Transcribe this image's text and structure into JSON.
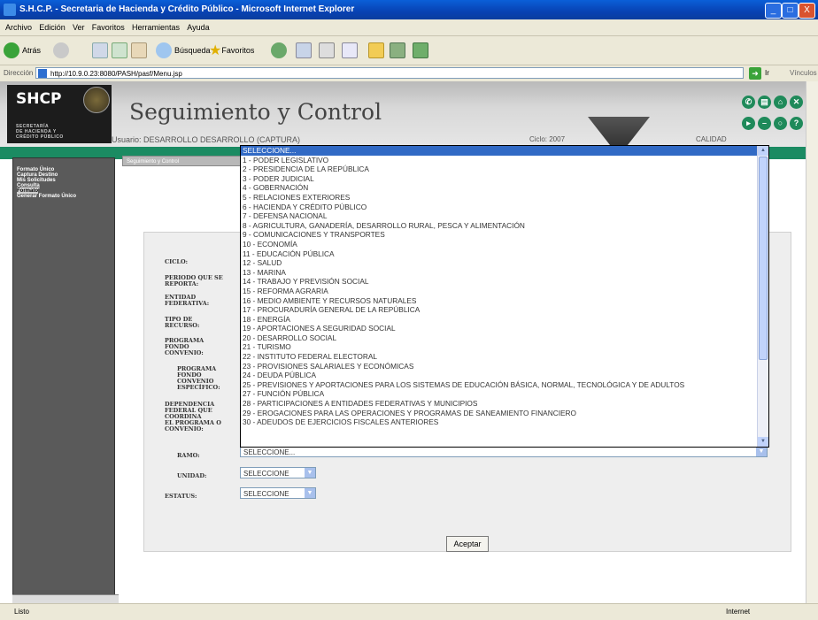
{
  "window": {
    "title": "S.H.C.P. - Secretaria de Hacienda y Crédito Público - Microsoft Internet Explorer",
    "controls": [
      "_",
      "□",
      "X"
    ]
  },
  "menubar": [
    "Archivo",
    "Edición",
    "Ver",
    "Favoritos",
    "Herramientas",
    "Ayuda"
  ],
  "toolbar": {
    "back_label": "Atrás",
    "search_label": "Búsqueda",
    "favorites_label": "Favoritos"
  },
  "address": {
    "label": "Dirección",
    "url": "http://10.9.0.23:8080/PASH/pasf/Menu.jsp",
    "go_label": "Ir",
    "links_label": "Vínculos"
  },
  "header": {
    "logo": "SHCP",
    "org_line1": "SECRETARÍA",
    "org_line2": "DE HACIENDA Y",
    "org_line3": "CRÉDITO PÚBLICO",
    "app_title": "Seguimiento y Control",
    "usuario": "Usuario: DESARROLLO DESARROLLO (CAPTURA)",
    "ciclo": "Ciclo: 2007",
    "calidad": "CALIDAD",
    "tab_label": "Seguimiento y Control"
  },
  "sidebar": [
    "Formato Único",
    "Captura Destino",
    "Mis Solicitudes",
    "Consulta",
    "Formato",
    "Generar Formato Único"
  ],
  "form": {
    "labels": {
      "ciclo": "CICLO:",
      "periodo1": "PERIODO QUE SE",
      "periodo2": "REPORTA:",
      "entidad1": "ENTIDAD",
      "entidad2": "FEDERATIVA:",
      "tipo1": "TIPO DE",
      "tipo2": "RECURSO:",
      "programa1": "PROGRAMA",
      "programa2": "FONDO",
      "programa3": "CONVENIO:",
      "prog_esp1": "PROGRAMA",
      "prog_esp2": "FONDO",
      "prog_esp3": "CONVENIO",
      "prog_esp4": "ESPECÍFICO:",
      "dep1": "DEPENDENCIA",
      "dep2": "FEDERAL QUE",
      "dep3": "COORDINA",
      "dep4": "EL PROGRAMA O",
      "dep5": "CONVENIO:",
      "ramo": "RAMO:",
      "unidad": "UNIDAD:",
      "estatus": "ESTATUS:"
    },
    "ramo_value": "SELECCIONE...",
    "unidad_value": "SELECCIONE",
    "estatus_value": "SELECCIONE",
    "aceptar": "Aceptar"
  },
  "ramo_options": [
    "SELECCIONE...",
    "1 - PODER LEGISLATIVO",
    "2 - PRESIDENCIA DE LA REPÚBLICA",
    "3 - PODER JUDICIAL",
    "4 - GOBERNACIÓN",
    "5 - RELACIONES EXTERIORES",
    "6 - HACIENDA Y CRÉDITO PÚBLICO",
    "7 - DEFENSA NACIONAL",
    "8 - AGRICULTURA, GANADERÍA, DESARROLLO RURAL, PESCA Y ALIMENTACIÓN",
    "9 - COMUNICACIONES Y TRANSPORTES",
    "10 - ECONOMÍA",
    "11 - EDUCACIÓN PÚBLICA",
    "12 - SALUD",
    "13 - MARINA",
    "14 - TRABAJO Y PREVISIÓN SOCIAL",
    "15 - REFORMA AGRARIA",
    "16 - MEDIO AMBIENTE Y RECURSOS NATURALES",
    "17 - PROCURADURÍA GENERAL DE LA REPÚBLICA",
    "18 - ENERGÍA",
    "19 - APORTACIONES A SEGURIDAD SOCIAL",
    "20 - DESARROLLO SOCIAL",
    "21 - TURISMO",
    "22 - INSTITUTO FEDERAL ELECTORAL",
    "23 - PROVISIONES SALARIALES Y ECONÓMICAS",
    "24 - DEUDA PÚBLICA",
    "25 - PREVISIONES Y APORTACIONES PARA LOS SISTEMAS DE EDUCACIÓN BÁSICA, NORMAL, TECNOLÓGICA Y DE ADULTOS",
    "27 - FUNCIÓN PÚBLICA",
    "28 - PARTICIPACIONES A ENTIDADES FEDERATIVAS Y MUNICIPIOS",
    "29 - EROGACIONES PARA LAS OPERACIONES Y PROGRAMAS DE SANEAMIENTO FINANCIERO",
    "30 - ADEUDOS DE EJERCICIOS FISCALES ANTERIORES"
  ],
  "status": {
    "text": "Listo",
    "zone": "Internet"
  },
  "colors": {
    "accent": "#1b8b62",
    "selection": "#316ac5",
    "titlebar": "#0a5fd8"
  }
}
